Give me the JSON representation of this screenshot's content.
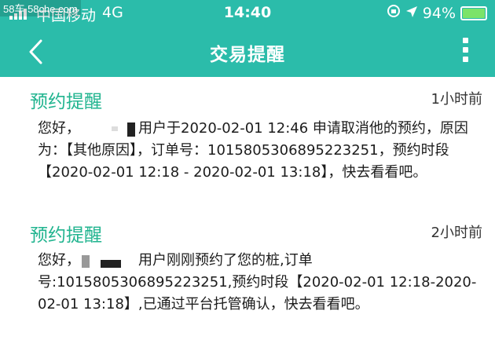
{
  "watermark": "58车 58che.com",
  "status": {
    "carrier": "中国移动",
    "network": "4G",
    "time": "14:40",
    "battery": "94%",
    "battery_level": 0.94
  },
  "nav": {
    "title": "交易提醒"
  },
  "messages": [
    {
      "title": "预约提醒",
      "time": "1小时前",
      "body_pre": "您好，",
      "body_post": "用户于2020-02-01 12:46 申请取消他的预约，原因为：【其他原因】，订单号：1015805306895223251，预约时段【2020-02-01 12:18 - 2020-02-01 13:18】，快去看看吧。"
    },
    {
      "title": "预约提醒",
      "time": "2小时前",
      "body_pre": "您好，",
      "body_post": "用户刚刚预约了您的桩,订单号:1015805306895223251,预约时段【2020-02-01 12:18-2020-02-01 13:18】,已通过平台托管确认，快去看看吧。"
    }
  ],
  "colors": {
    "header": "#2bbcaa",
    "title_accent": "#21b48f"
  }
}
